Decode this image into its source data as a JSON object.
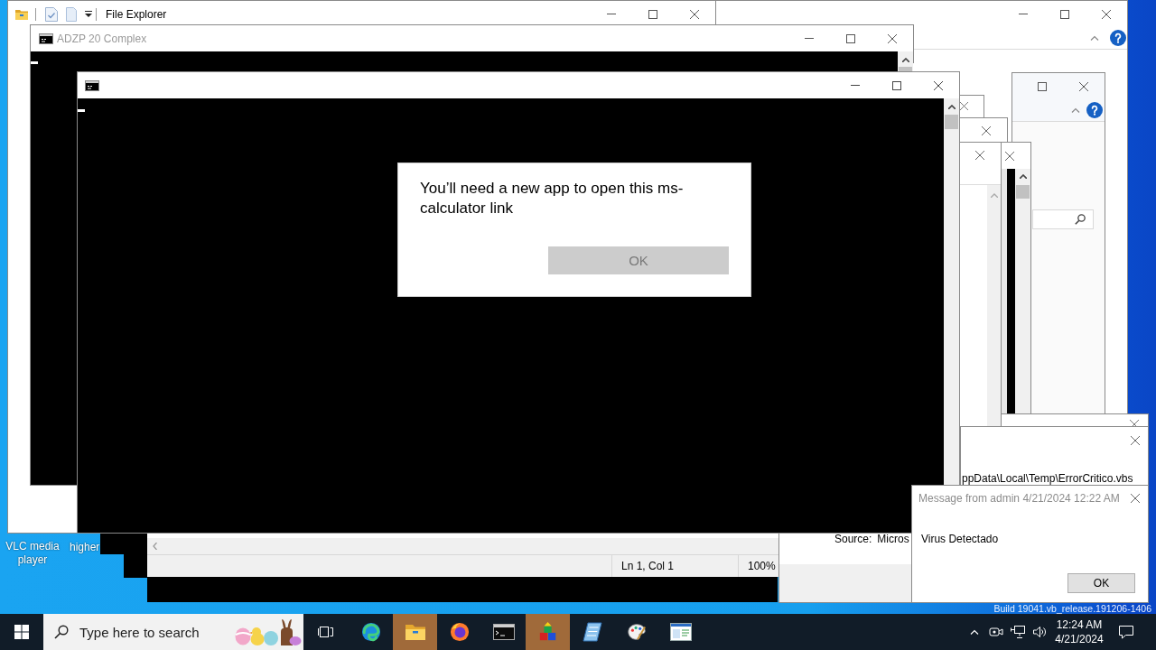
{
  "desktop": {
    "icon_labels": [
      "VLC media player",
      "higher"
    ],
    "build_text": "Build 19041.vb_release.191206-1406"
  },
  "explorer_window": {
    "title": "File Explorer"
  },
  "console_window": {
    "title": "ADZP 20 Complex"
  },
  "script_window": {
    "path": "ppData\\Local\\Temp\\ErrorCritico.vbs"
  },
  "message_box": {
    "title": "Message from admin 4/21/2024 12:22 AM",
    "text": "Virus Detectado",
    "button": "OK"
  },
  "event_window": {
    "source_label": "Source:",
    "source_value": "Micros"
  },
  "editor_status": {
    "position": "Ln 1, Col 1",
    "zoom": "100%"
  },
  "dialog": {
    "message": "You’ll need a new app to open this ms-calculator link",
    "button": {
      "label": "OK",
      "disabled": true
    }
  },
  "taskbar": {
    "search": {
      "placeholder": "Type here to search"
    },
    "apps": [
      {
        "kind": "swirl",
        "highlighted": false
      },
      {
        "kind": "folder",
        "highlighted": true
      },
      {
        "kind": "flame_globe",
        "highlighted": false
      },
      {
        "kind": "terminal",
        "highlighted": false
      },
      {
        "kind": "cubes",
        "highlighted": true
      },
      {
        "kind": "notebook",
        "highlighted": false
      },
      {
        "kind": "palette",
        "highlighted": false
      },
      {
        "kind": "window",
        "highlighted": false
      }
    ],
    "clock": {
      "time": "12:24 AM",
      "date": "4/21/2024"
    }
  }
}
